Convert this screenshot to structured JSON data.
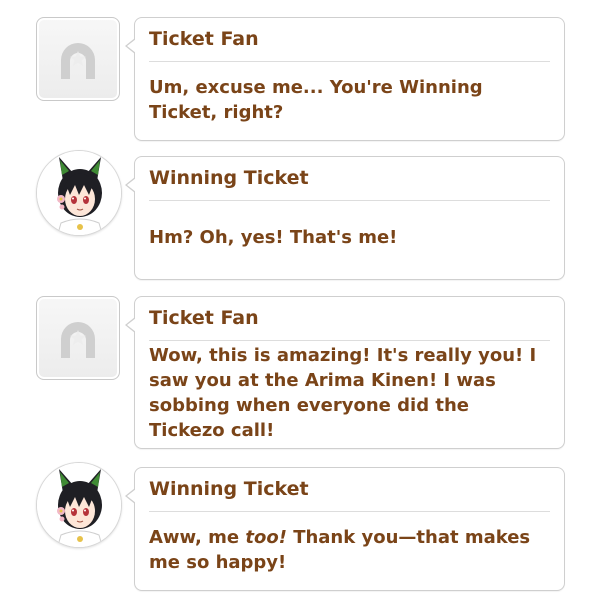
{
  "colors": {
    "text_brown": "#7a4418",
    "bubble_border": "#cfcfcf",
    "divider": "#dddddd",
    "horseshoe_gray": "#cfcfcf",
    "ear_green": "#3f8a34",
    "hair_black": "#1f1f24",
    "eye_red": "#b5333a",
    "bow_purple": "#4a3c8c"
  },
  "messages": [
    {
      "speaker": "Ticket Fan",
      "avatar": "horseshoe-placeholder-icon",
      "text": "Um, excuse me... You're Winning Ticket, right?"
    },
    {
      "speaker": "Winning Ticket",
      "avatar": "winning-ticket-portrait",
      "text": "Hm? Oh, yes! That's me!"
    },
    {
      "speaker": "Ticket Fan",
      "avatar": "horseshoe-placeholder-icon",
      "text": "Wow, this is amazing! It's really you! I saw you at the Arima Kinen! I was sobbing when everyone did the Tickezo call!"
    },
    {
      "speaker": "Winning Ticket",
      "avatar": "winning-ticket-portrait",
      "text_before": "Aww, me ",
      "text_emphasis": "too!",
      "text_after": " Thank you—that makes me so happy!"
    }
  ]
}
